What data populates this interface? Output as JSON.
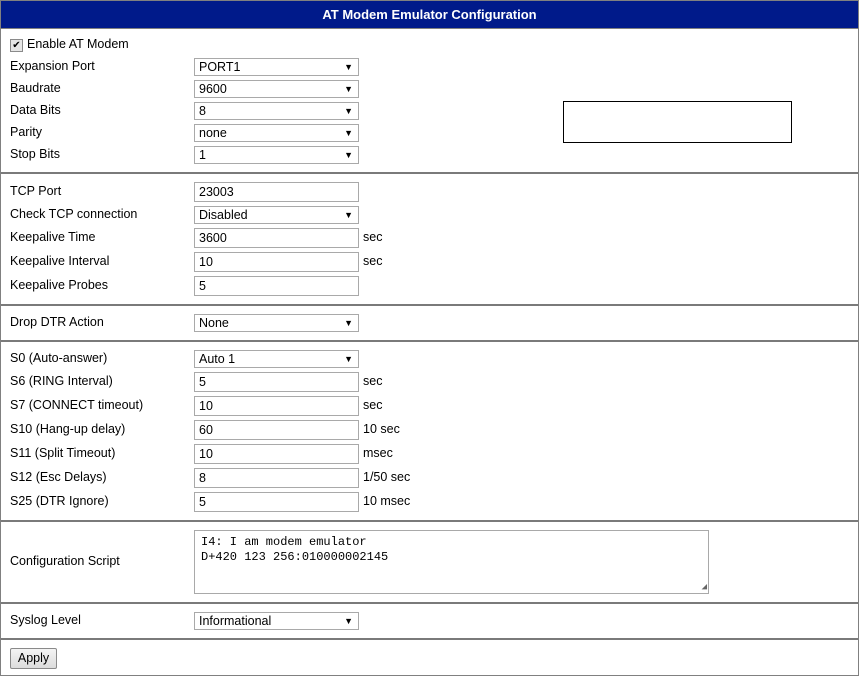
{
  "title": "AT Modem Emulator Configuration",
  "enable": {
    "label": "Enable AT Modem",
    "checked": true
  },
  "serial": {
    "expansion_port": {
      "label": "Expansion Port",
      "value": "PORT1"
    },
    "baudrate": {
      "label": "Baudrate",
      "value": "9600"
    },
    "data_bits": {
      "label": "Data Bits",
      "value": "8"
    },
    "parity": {
      "label": "Parity",
      "value": "none"
    },
    "stop_bits": {
      "label": "Stop Bits",
      "value": "1"
    }
  },
  "tcp": {
    "tcp_port": {
      "label": "TCP Port",
      "value": "23003"
    },
    "check_tcp": {
      "label": "Check TCP connection",
      "value": "Disabled"
    },
    "keepalive_time": {
      "label": "Keepalive Time",
      "value": "3600",
      "unit": "sec"
    },
    "keepalive_interval": {
      "label": "Keepalive Interval",
      "value": "10",
      "unit": "sec"
    },
    "keepalive_probes": {
      "label": "Keepalive Probes",
      "value": "5"
    }
  },
  "dtr": {
    "label": "Drop DTR Action",
    "value": "None"
  },
  "registers": {
    "s0": {
      "label": "S0 (Auto-answer)",
      "value": "Auto 1"
    },
    "s6": {
      "label": "S6 (RING Interval)",
      "value": "5",
      "unit": "sec"
    },
    "s7": {
      "label": "S7 (CONNECT timeout)",
      "value": "10",
      "unit": "sec"
    },
    "s10": {
      "label": "S10 (Hang-up delay)",
      "value": "60",
      "unit": "10 sec"
    },
    "s11": {
      "label": "S11 (Split Timeout)",
      "value": "10",
      "unit": "msec"
    },
    "s12": {
      "label": "S12 (Esc Delays)",
      "value": "8",
      "unit": "1/50 sec"
    },
    "s25": {
      "label": "S25 (DTR Ignore)",
      "value": "5",
      "unit": "10 msec"
    }
  },
  "script": {
    "label": "Configuration Script",
    "lines": [
      "I4: I am modem emulator",
      "D+420 123 256:010000002145"
    ]
  },
  "syslog": {
    "label": "Syslog Level",
    "value": "Informational"
  },
  "apply_label": "Apply"
}
